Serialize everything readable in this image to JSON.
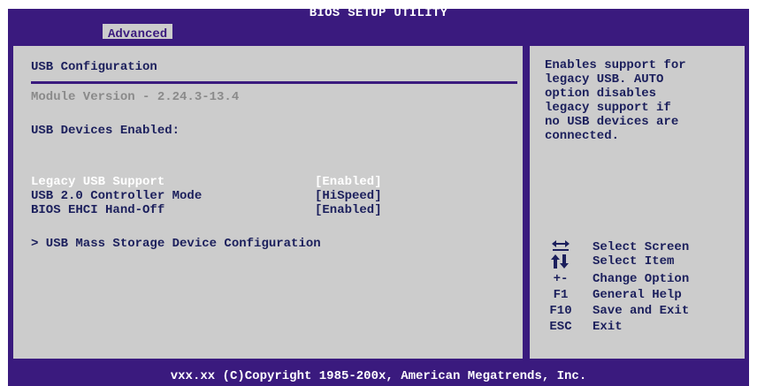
{
  "header": {
    "title": "BIOS SETUP UTILITY",
    "active_tab": "Advanced"
  },
  "main": {
    "section_title": "USB Configuration",
    "module_version": "Module Version - 2.24.3-13.4",
    "devices_enabled_label": "USB Devices Enabled:",
    "settings": [
      {
        "label": "Legacy USB Support",
        "value": "[Enabled]",
        "selected": true
      },
      {
        "label": "USB 2.0 Controller Mode",
        "value": "[HiSpeed]",
        "selected": false
      },
      {
        "label": "BIOS EHCI Hand-Off",
        "value": "[Enabled]",
        "selected": false
      }
    ],
    "submenu": "> USB Mass Storage Device Configuration"
  },
  "help": {
    "description": "Enables support for\nlegacy USB. AUTO\noption disables\nlegacy support if\nno USB devices are\nconnected.",
    "keys": [
      {
        "key_icon": "left-right-arrows-icon",
        "action": "Select Screen"
      },
      {
        "key_icon": "up-down-arrows-icon",
        "action": "Select Item"
      },
      {
        "key": "+-",
        "action": "Change Option"
      },
      {
        "key": "F1",
        "action": "General Help"
      },
      {
        "key": "F10",
        "action": "Save and Exit"
      },
      {
        "key": "ESC",
        "action": "Exit"
      }
    ]
  },
  "footer": {
    "copyright": "vxx.xx (C)Copyright 1985-200x, American Megatrends, Inc."
  },
  "colors": {
    "frame": "#3a1a7e",
    "panel": "#cccccc",
    "text": "#1b1f5c",
    "selected_text": "#ffffff",
    "disabled_text": "#8a8a8a"
  }
}
